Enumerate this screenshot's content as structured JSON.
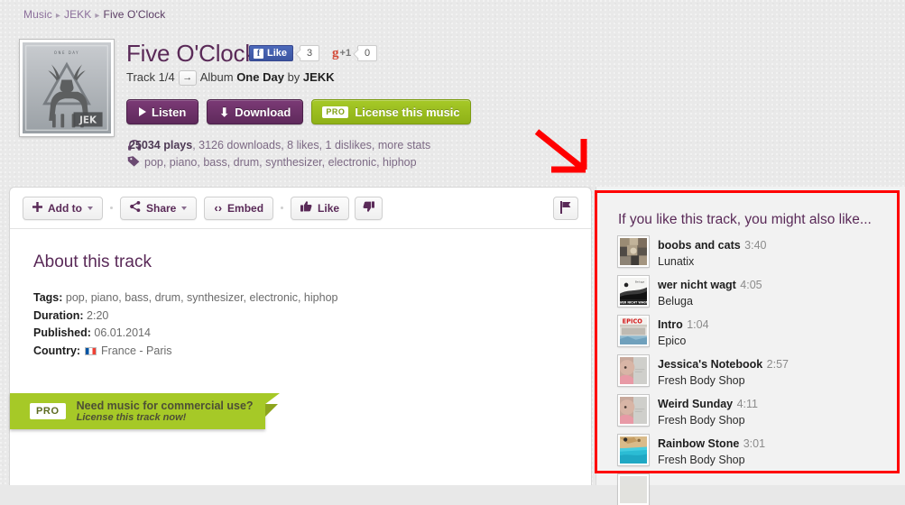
{
  "breadcrumb": {
    "items": [
      "Music",
      "JEKK",
      "Five O'Clock"
    ],
    "separator": "▸"
  },
  "track": {
    "title": "Five O'Clock",
    "track_position": "Track 1/4",
    "next_arrow": "→",
    "album_prefix": "Album",
    "album_name": "One Day",
    "by_word": "by",
    "artist": "JEKK",
    "cover_alt": "one-day-album-cover-stag-triangle",
    "cover_top_text": "ONE DAY",
    "cover_logo_text": "JEK"
  },
  "social": {
    "facebook_label": "Like",
    "facebook_icon": "f",
    "facebook_count": "3",
    "gplus_label": "g",
    "gplus_plus": "+1",
    "gplus_count": "0"
  },
  "actions": {
    "listen": "Listen",
    "download": "Download",
    "license": "License this music",
    "pro_badge": "PRO"
  },
  "stats": {
    "headphones_icon": "🎧",
    "plays": "25034 plays",
    "rest": ", 3126 downloads, 8 likes, 1 dislikes, more stats",
    "tag_icon": "🏷",
    "tags": "pop, piano, bass, drum, synthesizer, electronic, hiphop"
  },
  "toolbar": {
    "add_to": "Add to",
    "share": "Share",
    "embed": "Embed",
    "embed_icon": "‹›",
    "like": "Like",
    "dislike_icon": "dislike",
    "flag_icon": "flag"
  },
  "about": {
    "heading": "About this track",
    "rows": [
      {
        "key": "Tags:",
        "value": "pop, piano, bass, drum, synthesizer, electronic, hiphop"
      },
      {
        "key": "Duration:",
        "value": "2:20"
      },
      {
        "key": "Published:",
        "value": "06.01.2014"
      },
      {
        "key": "Country:",
        "value": "France - Paris"
      }
    ]
  },
  "ribbon": {
    "badge": "PRO",
    "line1": "Need music for commercial use?",
    "line2": "License this track now!"
  },
  "sidebar": {
    "heading": "If you like this track, you might also like...",
    "recommendations": [
      {
        "title": "boobs and cats",
        "duration": "3:40",
        "artist": "Lunatix",
        "art": "collage"
      },
      {
        "title": "wer nicht wagt",
        "duration": "4:05",
        "artist": "Beluga",
        "art": "beluga"
      },
      {
        "title": "Intro",
        "duration": "1:04",
        "artist": "Epico",
        "art": "epico"
      },
      {
        "title": "Jessica's Notebook",
        "duration": "2:57",
        "artist": "Fresh Body Shop",
        "art": "baby"
      },
      {
        "title": "Weird Sunday",
        "duration": "4:11",
        "artist": "Fresh Body Shop",
        "art": "baby"
      },
      {
        "title": "Rainbow Stone",
        "duration": "3:01",
        "artist": "Fresh Body Shop",
        "art": "beach"
      }
    ]
  },
  "annotations": {
    "arrow_color": "#ff0000",
    "highlight_color": "#ff0000"
  },
  "colors": {
    "brand_purple": "#5a2a58",
    "accent_green": "#a6c927",
    "page_bg": "#e9e9e9",
    "panel_bg": "#ffffff",
    "sidebar_bg": "#f2f2f2"
  }
}
